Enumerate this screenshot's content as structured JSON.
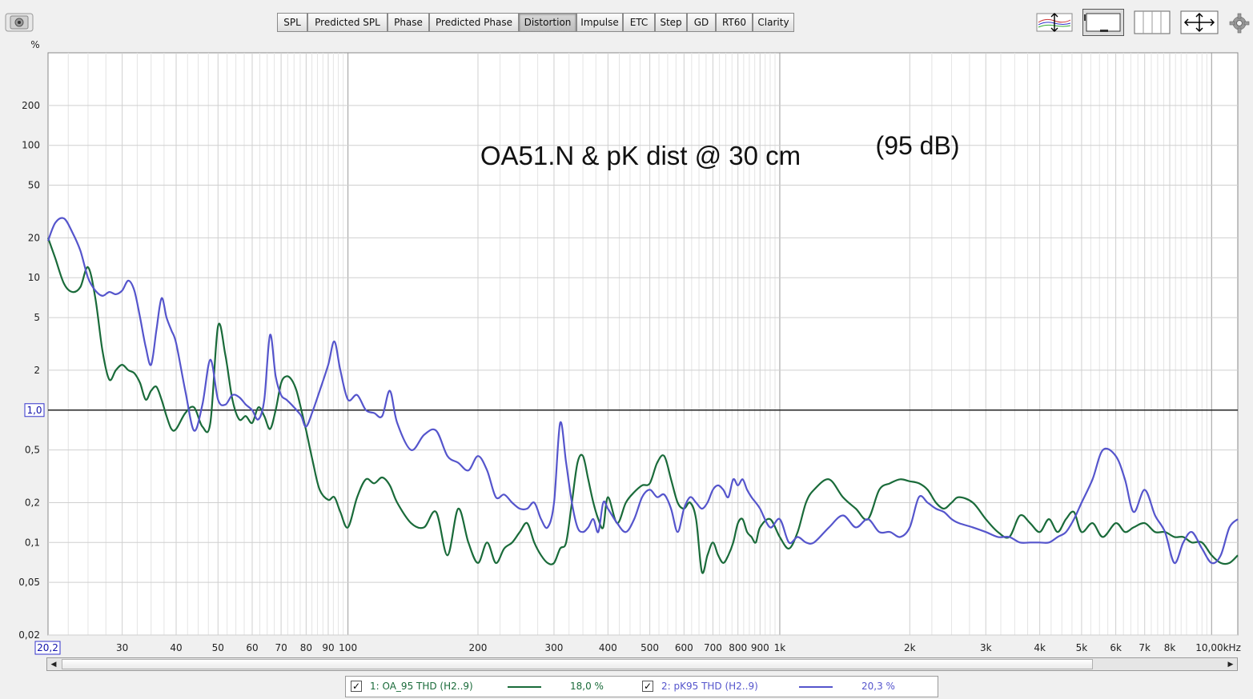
{
  "toolbar": {
    "tabs": [
      {
        "label": "SPL",
        "left": 346,
        "width": 38
      },
      {
        "label": "Predicted SPL",
        "left": 384,
        "width": 100
      },
      {
        "label": "Phase",
        "left": 484,
        "width": 52
      },
      {
        "label": "Predicted Phase",
        "left": 536,
        "width": 112
      },
      {
        "label": "Distortion",
        "left": 648,
        "width": 72,
        "active": true
      },
      {
        "label": "Impulse",
        "left": 720,
        "width": 58
      },
      {
        "label": "ETC",
        "left": 778,
        "width": 40
      },
      {
        "label": "Step",
        "left": 818,
        "width": 40
      },
      {
        "label": "GD",
        "left": 858,
        "width": 36
      },
      {
        "label": "RT60",
        "left": 894,
        "width": 46
      },
      {
        "label": "Clarity",
        "left": 940,
        "width": 52
      }
    ]
  },
  "legend": {
    "items": [
      {
        "label": "1: OA_95 THD (H2..9)",
        "value": "18,0 %",
        "color": "#1a6b3a"
      },
      {
        "label": "2: pK95 THD (H2..9)",
        "value": "20,3 %",
        "color": "#5555cc"
      }
    ]
  },
  "chart_data": {
    "type": "line",
    "title": "OA51.N & pK dist @ 30 cm",
    "subtitle": "(95 dB)",
    "ylabel": "%",
    "xlabel": "",
    "x_scale": "log",
    "y_scale": "log",
    "xlim": [
      20.2,
      11500
    ],
    "ylim": [
      0.02,
      500
    ],
    "x_ticks": [
      {
        "v": 30,
        "l": "30"
      },
      {
        "v": 40,
        "l": "40"
      },
      {
        "v": 50,
        "l": "50"
      },
      {
        "v": 60,
        "l": "60"
      },
      {
        "v": 70,
        "l": "70"
      },
      {
        "v": 80,
        "l": "80"
      },
      {
        "v": 90,
        "l": "90"
      },
      {
        "v": 100,
        "l": "100"
      },
      {
        "v": 200,
        "l": "200"
      },
      {
        "v": 300,
        "l": "300"
      },
      {
        "v": 400,
        "l": "400"
      },
      {
        "v": 500,
        "l": "500"
      },
      {
        "v": 600,
        "l": "600"
      },
      {
        "v": 700,
        "l": "700"
      },
      {
        "v": 800,
        "l": "800"
      },
      {
        "v": 900,
        "l": "900"
      },
      {
        "v": 1000,
        "l": "1k"
      },
      {
        "v": 2000,
        "l": "2k"
      },
      {
        "v": 3000,
        "l": "3k"
      },
      {
        "v": 4000,
        "l": "4k"
      },
      {
        "v": 5000,
        "l": "5k"
      },
      {
        "v": 6000,
        "l": "6k"
      },
      {
        "v": 7000,
        "l": "7k"
      },
      {
        "v": 8000,
        "l": "8k"
      },
      {
        "v": 10000,
        "l": "10,00kHz"
      }
    ],
    "x_start_label": "20,2",
    "y_ticks": [
      {
        "v": 200,
        "l": "200"
      },
      {
        "v": 100,
        "l": "100"
      },
      {
        "v": 50,
        "l": "50"
      },
      {
        "v": 20,
        "l": "20"
      },
      {
        "v": 10,
        "l": "10"
      },
      {
        "v": 5,
        "l": "5"
      },
      {
        "v": 2,
        "l": "2"
      },
      {
        "v": 0.5,
        "l": "0,5"
      },
      {
        "v": 0.2,
        "l": "0,2"
      },
      {
        "v": 0.1,
        "l": "0,1"
      },
      {
        "v": 0.05,
        "l": "0,05"
      },
      {
        "v": 0.02,
        "l": "0,02"
      }
    ],
    "y_marker": {
      "v": 1.0,
      "l": "1,0"
    },
    "grid": true,
    "legend_position": "bottom",
    "series": [
      {
        "name": "1: OA_95 THD (H2..9)",
        "color": "#1a6b3a",
        "x": [
          20.2,
          21,
          22,
          23,
          24,
          25,
          26,
          27,
          28,
          29,
          30,
          31,
          32,
          33,
          34,
          35,
          36,
          37,
          38,
          39,
          40,
          42,
          44,
          46,
          48,
          50,
          52,
          54,
          56,
          58,
          60,
          62,
          64,
          66,
          68,
          70,
          72,
          74,
          76,
          78,
          80,
          83,
          86,
          90,
          93,
          96,
          100,
          105,
          110,
          115,
          120,
          125,
          130,
          140,
          150,
          160,
          170,
          180,
          190,
          200,
          210,
          220,
          230,
          240,
          250,
          260,
          270,
          280,
          290,
          300,
          310,
          320,
          330,
          340,
          350,
          360,
          370,
          380,
          390,
          400,
          420,
          440,
          460,
          480,
          500,
          520,
          540,
          560,
          580,
          600,
          620,
          640,
          660,
          680,
          700,
          720,
          740,
          760,
          780,
          800,
          820,
          840,
          860,
          880,
          900,
          950,
          1000,
          1050,
          1100,
          1150,
          1200,
          1300,
          1400,
          1500,
          1600,
          1700,
          1800,
          1900,
          2000,
          2100,
          2200,
          2300,
          2400,
          2500,
          2600,
          2800,
          3000,
          3200,
          3400,
          3600,
          3800,
          4000,
          4200,
          4400,
          4600,
          4800,
          5000,
          5300,
          5600,
          6000,
          6300,
          6600,
          7000,
          7400,
          7800,
          8200,
          8600,
          9000,
          9500,
          10000,
          10500,
          11000,
          11500
        ],
        "y": [
          20,
          14,
          9,
          7.8,
          8.5,
          12,
          7,
          2.8,
          1.7,
          2,
          2.2,
          2,
          1.9,
          1.6,
          1.2,
          1.4,
          1.5,
          1.2,
          0.9,
          0.72,
          0.72,
          0.95,
          1.05,
          0.75,
          0.8,
          4.3,
          2.6,
          1.2,
          0.85,
          0.9,
          0.8,
          1.05,
          0.9,
          0.72,
          1,
          1.6,
          1.8,
          1.7,
          1.4,
          1.0,
          0.7,
          0.4,
          0.25,
          0.21,
          0.22,
          0.17,
          0.13,
          0.22,
          0.3,
          0.28,
          0.31,
          0.27,
          0.2,
          0.14,
          0.13,
          0.17,
          0.08,
          0.18,
          0.1,
          0.07,
          0.1,
          0.07,
          0.09,
          0.1,
          0.12,
          0.14,
          0.1,
          0.08,
          0.07,
          0.07,
          0.09,
          0.1,
          0.2,
          0.4,
          0.45,
          0.3,
          0.2,
          0.15,
          0.13,
          0.22,
          0.14,
          0.2,
          0.24,
          0.27,
          0.28,
          0.4,
          0.45,
          0.3,
          0.2,
          0.18,
          0.2,
          0.15,
          0.06,
          0.08,
          0.1,
          0.08,
          0.07,
          0.08,
          0.1,
          0.14,
          0.15,
          0.12,
          0.11,
          0.1,
          0.13,
          0.15,
          0.11,
          0.09,
          0.12,
          0.2,
          0.25,
          0.3,
          0.22,
          0.18,
          0.15,
          0.25,
          0.28,
          0.3,
          0.29,
          0.28,
          0.25,
          0.2,
          0.18,
          0.2,
          0.22,
          0.2,
          0.15,
          0.12,
          0.11,
          0.16,
          0.14,
          0.12,
          0.15,
          0.12,
          0.15,
          0.17,
          0.12,
          0.14,
          0.11,
          0.14,
          0.12,
          0.13,
          0.14,
          0.12,
          0.12,
          0.11,
          0.11,
          0.1,
          0.1,
          0.08,
          0.07,
          0.07,
          0.08
        ]
      },
      {
        "name": "2: pK95 THD (H2..9)",
        "color": "#5555cc",
        "x": [
          20.2,
          21,
          22,
          23,
          24,
          25,
          26,
          27,
          28,
          29,
          30,
          31,
          32,
          33,
          34,
          35,
          36,
          37,
          38,
          39,
          40,
          42,
          44,
          46,
          48,
          50,
          52,
          54,
          56,
          58,
          60,
          62,
          64,
          66,
          68,
          70,
          72,
          74,
          76,
          78,
          80,
          83,
          86,
          90,
          93,
          96,
          100,
          105,
          110,
          115,
          120,
          125,
          130,
          140,
          150,
          160,
          170,
          180,
          190,
          200,
          210,
          220,
          230,
          240,
          250,
          260,
          270,
          280,
          290,
          300,
          310,
          320,
          330,
          340,
          350,
          360,
          370,
          380,
          390,
          400,
          420,
          440,
          460,
          480,
          500,
          520,
          540,
          560,
          580,
          600,
          620,
          640,
          660,
          680,
          700,
          720,
          740,
          760,
          780,
          800,
          820,
          840,
          860,
          880,
          900,
          950,
          1000,
          1050,
          1100,
          1150,
          1200,
          1300,
          1400,
          1500,
          1600,
          1700,
          1800,
          1900,
          2000,
          2100,
          2200,
          2300,
          2400,
          2500,
          2600,
          2800,
          3000,
          3200,
          3400,
          3600,
          3800,
          4000,
          4200,
          4400,
          4600,
          4800,
          5000,
          5300,
          5600,
          6000,
          6300,
          6600,
          7000,
          7400,
          7800,
          8200,
          8600,
          9000,
          9500,
          10000,
          10500,
          11000,
          11500
        ],
        "y": [
          19,
          26,
          28,
          22,
          16,
          10,
          8,
          7.3,
          7.8,
          7.5,
          8,
          9.5,
          8,
          5,
          3,
          2.2,
          4,
          7,
          5,
          4,
          3.2,
          1.4,
          0.7,
          1.1,
          2.4,
          1.2,
          1.1,
          1.3,
          1.25,
          1.1,
          1.0,
          0.85,
          1.2,
          3.7,
          1.8,
          1.3,
          1.2,
          1.1,
          1.0,
          0.9,
          0.75,
          1.0,
          1.4,
          2.2,
          3.3,
          2.0,
          1.2,
          1.3,
          1.0,
          0.95,
          0.9,
          1.4,
          0.8,
          0.5,
          0.65,
          0.7,
          0.45,
          0.4,
          0.35,
          0.45,
          0.35,
          0.22,
          0.23,
          0.2,
          0.18,
          0.18,
          0.2,
          0.15,
          0.13,
          0.2,
          0.8,
          0.4,
          0.2,
          0.13,
          0.12,
          0.13,
          0.15,
          0.12,
          0.2,
          0.18,
          0.14,
          0.12,
          0.15,
          0.22,
          0.25,
          0.22,
          0.23,
          0.18,
          0.12,
          0.18,
          0.22,
          0.2,
          0.18,
          0.2,
          0.25,
          0.27,
          0.25,
          0.22,
          0.3,
          0.27,
          0.3,
          0.25,
          0.22,
          0.2,
          0.18,
          0.13,
          0.15,
          0.1,
          0.11,
          0.1,
          0.1,
          0.13,
          0.16,
          0.13,
          0.15,
          0.12,
          0.12,
          0.11,
          0.13,
          0.22,
          0.2,
          0.18,
          0.17,
          0.15,
          0.14,
          0.13,
          0.12,
          0.11,
          0.11,
          0.1,
          0.1,
          0.1,
          0.1,
          0.11,
          0.12,
          0.15,
          0.2,
          0.3,
          0.5,
          0.45,
          0.3,
          0.17,
          0.25,
          0.16,
          0.12,
          0.07,
          0.1,
          0.12,
          0.09,
          0.07,
          0.08,
          0.13,
          0.15
        ]
      }
    ]
  }
}
